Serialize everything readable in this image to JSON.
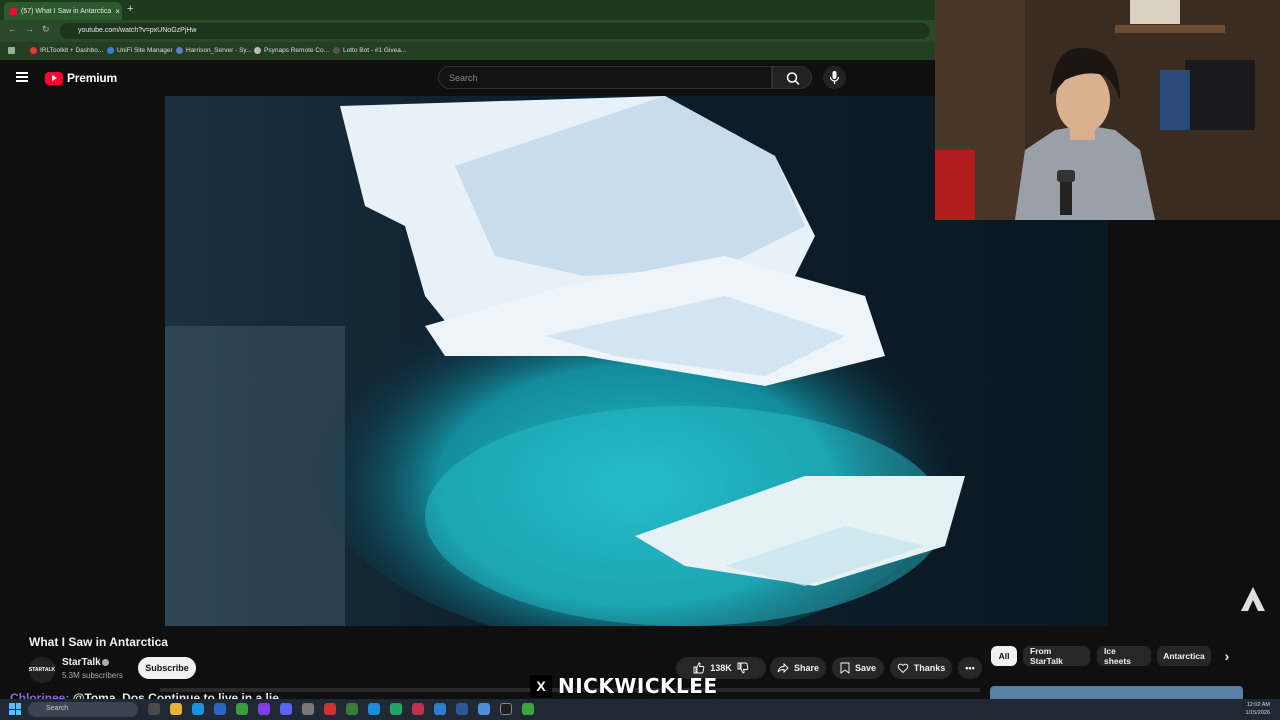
{
  "browser": {
    "tab_title": "(57) What I Saw in Antarctica",
    "new_tab": "+",
    "url": "youtube.com/watch?v=pxUNoGzPjHw",
    "bookmarks": [
      "IRLToolkit + Dashbo...",
      "UniFi Site Manager",
      "Harrison_Server - Sy...",
      "Psynaps Remote Co...",
      "Lotto Bot - #1 Givea..."
    ]
  },
  "youtube": {
    "logo_text": "Premium",
    "search_placeholder": "Search"
  },
  "video": {
    "title": "What I Saw in Antarctica",
    "channel": {
      "name": "StarTalk",
      "avatar_text": "STARTALK",
      "subscribers": "5.3M subscribers",
      "subscribe_label": "Subscribe"
    },
    "actions": {
      "likes": "138K",
      "share": "Share",
      "save": "Save",
      "thanks": "Thanks",
      "more": "•••"
    }
  },
  "chips": {
    "items": [
      "All",
      "From StarTalk",
      "Ice sheets",
      "Antarctica"
    ],
    "next": "›"
  },
  "overlay": {
    "chat_user": "Chlorinee:",
    "chat_message": "@Toma_Dos Continue to live in a lie",
    "brand_x": "X",
    "brand_name": "NICKWICKLEE"
  },
  "taskbar": {
    "search_placeholder": "Search",
    "time": "12:02 AM",
    "date": "1/15/2026"
  },
  "colors": {
    "youtube_red": "#ff0033",
    "browser_green": "#2a482a",
    "page_bg": "#0f0f0f",
    "taskbar": "#202833"
  }
}
